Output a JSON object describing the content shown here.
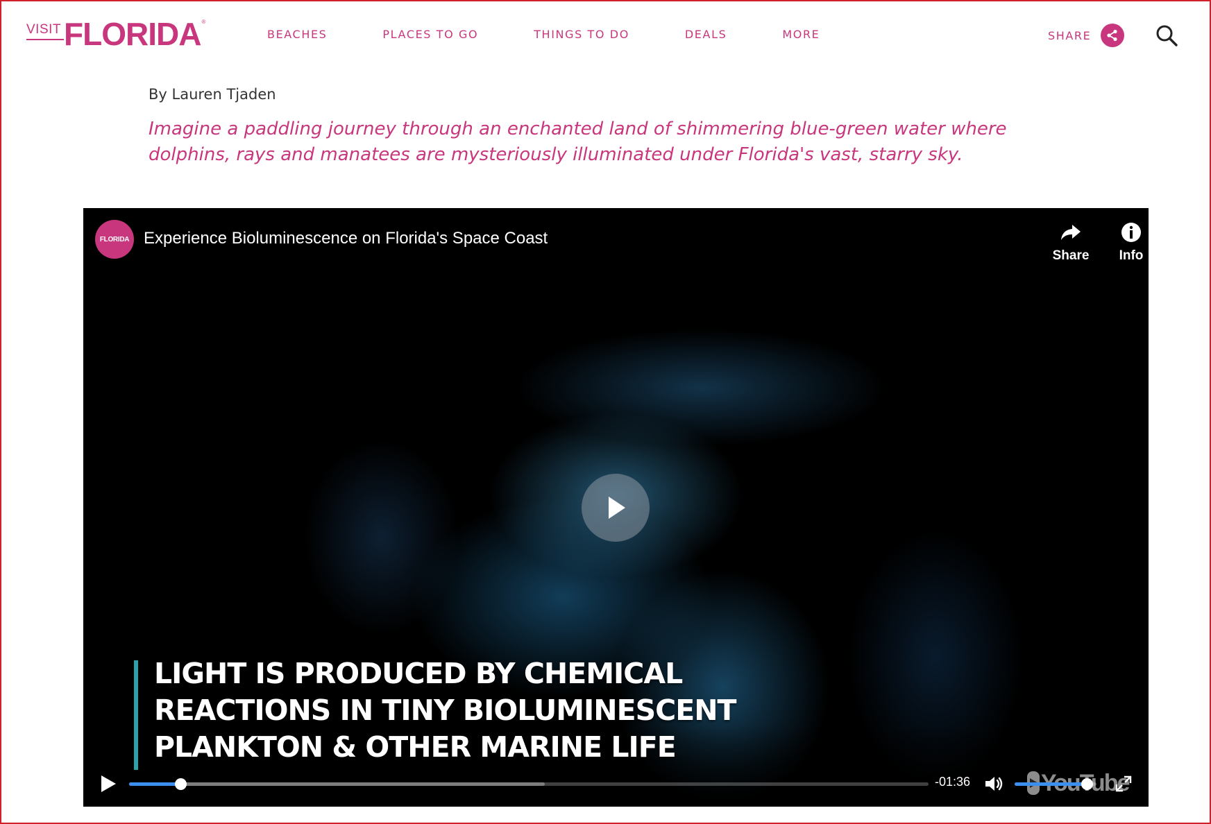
{
  "brand": {
    "visit": "VISIT",
    "florida": "FLORIDA",
    "reg": "®",
    "color": "#c8377d"
  },
  "nav": {
    "items": [
      {
        "label": "BEACHES"
      },
      {
        "label": "PLACES TO GO"
      },
      {
        "label": "THINGS TO DO"
      },
      {
        "label": "DEALS"
      },
      {
        "label": "MORE"
      }
    ]
  },
  "header": {
    "share_label": "SHARE",
    "share_icon": "share-icon",
    "search_icon": "search-icon"
  },
  "article": {
    "byline": "By Lauren Tjaden",
    "intro": "Imagine a paddling journey through an enchanted land of shimmering blue-green water where dolphins, rays and manatees are mysteriously illuminated under Florida's vast, starry sky."
  },
  "video": {
    "channel_avatar_text": "FLORIDA",
    "title": "Experience Bioluminescence on Florida's Space Coast",
    "share_label": "Share",
    "info_label": "Info",
    "caption_lines": [
      "LIGHT IS PRODUCED BY CHEMICAL",
      "REACTIONS IN TINY BIOLUMINESCENT",
      "PLANKTON & OTHER MARINE LIFE"
    ],
    "time_remaining": "-01:36",
    "progress_fraction": 0.064,
    "buffered_fraction": 0.52,
    "volume_fraction": 0.88,
    "accent_color": "#3d8ef1",
    "caption_bar_color": "#2aa3a8",
    "watermark": "YouTube"
  }
}
